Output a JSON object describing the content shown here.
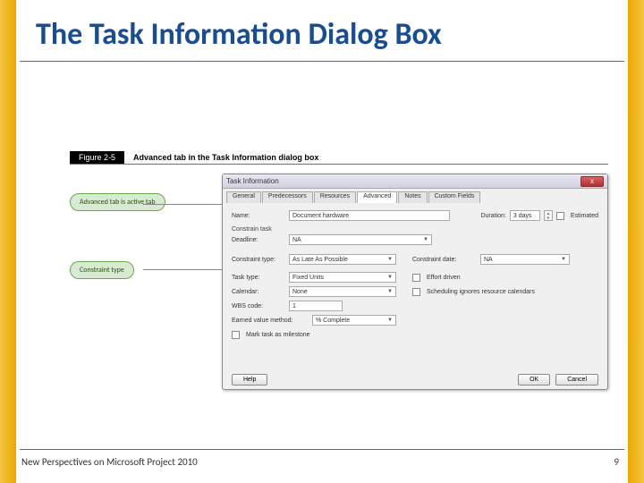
{
  "slide": {
    "title": "The Task Information Dialog Box",
    "footer": "New Perspectives on Microsoft Project 2010",
    "page": "9"
  },
  "figure": {
    "label": "Figure 2-5",
    "caption": "Advanced tab in the Task Information dialog box"
  },
  "callouts": {
    "advanced": "Advanced tab is active tab",
    "constraint": "Constraint type"
  },
  "dialog": {
    "title": "Task Information",
    "close": "x",
    "tabs": {
      "general": "General",
      "predecessors": "Predecessors",
      "resources": "Resources",
      "advanced": "Advanced",
      "notes": "Notes",
      "custom": "Custom Fields"
    },
    "fields": {
      "name_label": "Name:",
      "name_value": "Document hardware",
      "duration_label": "Duration:",
      "duration_value": "3 days",
      "estimated_label": "Estimated",
      "constrain_section": "Constrain task",
      "deadline_label": "Deadline:",
      "deadline_value": "NA",
      "constraint_type_label": "Constraint type:",
      "constraint_type_value": "As Late As Possible",
      "constraint_date_label": "Constraint date:",
      "constraint_date_value": "NA",
      "task_type_label": "Task type:",
      "task_type_value": "Fixed Units",
      "effort_driven_label": "Effort driven",
      "calendar_label": "Calendar:",
      "calendar_value": "None",
      "sched_ignores_label": "Scheduling ignores resource calendars",
      "wbs_label": "WBS code:",
      "wbs_value": "1",
      "evm_label": "Earned value method:",
      "evm_value": "% Complete",
      "milestone_label": "Mark task as milestone"
    },
    "buttons": {
      "help": "Help",
      "ok": "OK",
      "cancel": "Cancel"
    }
  }
}
